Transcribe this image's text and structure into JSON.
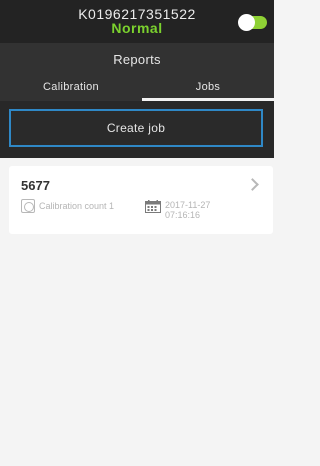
{
  "device": {
    "id": "K0196217351522",
    "status": "Normal",
    "toggle_on": true
  },
  "header": {
    "title": "Reports",
    "tabs": [
      "Calibration",
      "Jobs"
    ],
    "active_tab": "Jobs"
  },
  "actions": {
    "create_job_label": "Create job"
  },
  "jobs": [
    {
      "id": "5677",
      "calibration_count": "Calibration count 1",
      "date": "2017-11-27",
      "time": "07:16:16"
    }
  ],
  "colors": {
    "status_green": "#7bd12e",
    "accent_blue": "#2f88c6",
    "toggle_green": "#8fd135"
  }
}
